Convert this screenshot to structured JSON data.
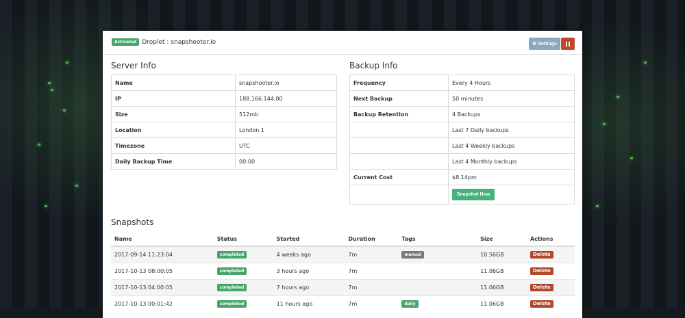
{
  "header": {
    "status_badge": "Activated",
    "droplet_label": "Droplet : snapshooter.io",
    "settings_label": "Settings",
    "settings_icon": "gear-icon",
    "pause_icon": "pause-icon"
  },
  "server_info": {
    "title": "Server Info",
    "rows": [
      {
        "key": "Name",
        "value": "snapshooter.io"
      },
      {
        "key": "IP",
        "value": "188.166.144.80"
      },
      {
        "key": "Size",
        "value": "512mb"
      },
      {
        "key": "Location",
        "value": "London 1"
      },
      {
        "key": "Timezone",
        "value": "UTC"
      },
      {
        "key": "Daily Backup Time",
        "value": "00:00"
      }
    ]
  },
  "backup_info": {
    "title": "Backup Info",
    "rows": [
      {
        "key": "Frequency",
        "value": "Every 4 Hours"
      },
      {
        "key": "Next Backup",
        "value": "50 minutes"
      },
      {
        "key": "Backup Retention",
        "value": "4 Backups"
      },
      {
        "key": "",
        "value": "Last 7 Daily backups"
      },
      {
        "key": "",
        "value": "Last 4 Weekly backups"
      },
      {
        "key": "",
        "value": "Last 4 Monthly backups"
      },
      {
        "key": "Current Cost",
        "value": "$8.14pm"
      }
    ],
    "snapshot_now_label": "Snapshot Now"
  },
  "snapshots": {
    "title": "Snapshots",
    "columns": [
      "Name",
      "Status",
      "Started",
      "Duration",
      "Tags",
      "Size",
      "Actions"
    ],
    "rows": [
      {
        "name": "2017-09-14 11:23:04",
        "status": "completed",
        "started": "4 weeks ago",
        "duration": "7m",
        "tag": "manual",
        "size": "10.56GB",
        "action": "Delete"
      },
      {
        "name": "2017-10-13 08:00:05",
        "status": "completed",
        "started": "3 hours ago",
        "duration": "7m",
        "tag": "",
        "size": "11.06GB",
        "action": "Delete"
      },
      {
        "name": "2017-10-13 04:00:05",
        "status": "completed",
        "started": "7 hours ago",
        "duration": "7m",
        "tag": "",
        "size": "11.06GB",
        "action": "Delete"
      },
      {
        "name": "2017-10-13 00:01:42",
        "status": "completed",
        "started": "11 hours ago",
        "duration": "7m",
        "tag": "daily",
        "size": "11.06GB",
        "action": "Delete"
      }
    ]
  },
  "colors": {
    "accent_green": "#47a56b",
    "danger": "#b2472a",
    "settings_blue": "#8fa6c0"
  }
}
